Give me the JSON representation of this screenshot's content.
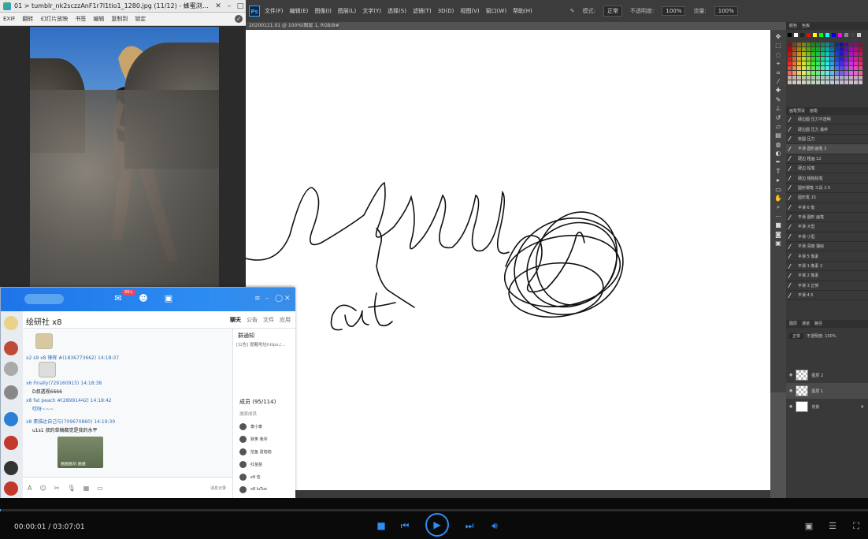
{
  "viewer": {
    "title": "01 > tumblr_nk2sczzAnF1r7l1tio1_1280.jpg (11/12) - 蜂蜜浏览器 5...",
    "toolbar": [
      "EXIF",
      "翻转",
      "幻灯片放映",
      "书签",
      "编辑",
      "复制到",
      "锁定"
    ]
  },
  "photoshop": {
    "menus": [
      "文件(F)",
      "编辑(E)",
      "图像(I)",
      "图层(L)",
      "文字(Y)",
      "选择(S)",
      "滤镜(T)",
      "3D(D)",
      "视图(V)",
      "窗口(W)",
      "帮助(H)"
    ],
    "options": {
      "mode_label": "模式:",
      "mode_value": "正常",
      "opacity_label": "不透明度:",
      "opacity_value": "100%",
      "flow_label": "流量:",
      "flow_value": "100%"
    },
    "doc_tab": "20200111.01 @ 100%(图层 1, RGB/8#) *",
    "panel_tabs": [
      "颜色",
      "色板"
    ],
    "brush_tabs": [
      "画笔预设",
      "画笔"
    ],
    "brushes": [
      "硬边圆 压力不透明",
      "硬边圆 压力 最终",
      "软圆 压力",
      "平滑 圆形画笔 3",
      "硬边 粗画 12",
      "硬边 铅笔",
      "硬边 粗糙铅笔",
      "圆形钢笔 工具 2.5",
      "圆形笔 15",
      "平滑 6 笔",
      "平滑 圆形 画笔",
      "平滑 大型",
      "平滑 小型",
      "平滑 深度 描绘",
      "平滑 5 像素",
      "平滑 1 像素 2",
      "平滑 2 像素",
      "平滑 3 正常",
      "平滑 4.5"
    ],
    "layer_tabs": [
      "图层",
      "通道",
      "路径"
    ],
    "layer_mode": "正常",
    "layer_opacity": "不透明度: 100%",
    "layers": [
      {
        "name": "图层 2"
      },
      {
        "name": "图层 1"
      },
      {
        "name": "背景"
      }
    ],
    "canvas_text": "cut"
  },
  "qq": {
    "badge": "99+",
    "group_name": "绘研社 x8",
    "tabs": [
      "聊天",
      "公告",
      "文件",
      "应用"
    ],
    "messages": [
      {
        "meta": "x2 s9 x8 锋辉 #(1836773662)  14:18:37",
        "body": ""
      },
      {
        "meta": "x6 Finally(729160915)  14:18:38",
        "body": "D叔透视6666"
      },
      {
        "meta": "x8 fat peach #(28991442)  14:18:42",
        "body": "哎呀~~~"
      },
      {
        "meta": "x8 素描达自己与(709670860)  14:19:30",
        "body": "u1s1 叔的草稿都觉是我的水平"
      }
    ],
    "photo_caption": "画画画功 画画",
    "notice_title": "群通知",
    "notice_text": "[公告] 提醒地址https:/...",
    "members_title": "成员 (95/114)",
    "members_search": "搜索成员",
    "members": [
      "泰小泰",
      "默笑 我爷",
      "挖鱼 雷炮炮",
      "红苗苗",
      "x8 伍",
      "x8 luTuo"
    ],
    "history": "消息记录"
  },
  "player": {
    "time": "00:00:01 / 03:07:01",
    "progress": 0.0001
  }
}
